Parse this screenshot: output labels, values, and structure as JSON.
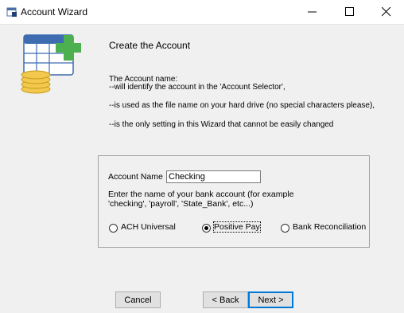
{
  "window": {
    "title": "Account Wizard"
  },
  "page": {
    "heading": "Create the Account",
    "description": [
      "The Account name:",
      "--will identify the account in the 'Account Selector',",
      "--is used as the file name on your hard drive (no special characters please),",
      "--is the only setting in this Wizard that cannot be easily changed"
    ]
  },
  "form": {
    "account_name_label": "Account Name",
    "account_name_value": "Checking",
    "hint_line1": "Enter the name of your bank account (for example",
    "hint_line2": "'checking', 'payroll', 'State_Bank', etc...)",
    "radios": [
      {
        "label": "ACH Universal",
        "selected": false
      },
      {
        "label": "Positive Pay",
        "selected": true
      },
      {
        "label": "Bank Reconciliation",
        "selected": false
      }
    ]
  },
  "buttons": {
    "cancel": "Cancel",
    "back": "< Back",
    "next": "Next >"
  },
  "colors": {
    "accent_green": "#4caf50",
    "money_gold": "#f2c94c",
    "focus_blue": "#0078d7"
  }
}
